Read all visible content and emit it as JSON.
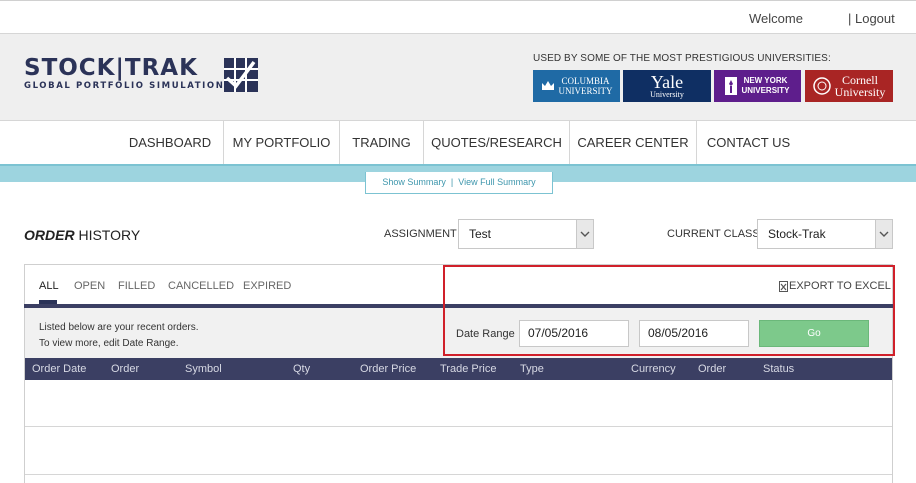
{
  "topbar": {
    "welcome": "Welcome",
    "logout": "| Logout"
  },
  "logo": {
    "name": "STOCK|TRAK",
    "tagline": "GLOBAL PORTFOLIO SIMULATIONS"
  },
  "universities": {
    "heading": "USED BY SOME OF THE MOST PRESTIGIOUS UNIVERSITIES:",
    "columbia_line1": "COLUMBIA",
    "columbia_line2": "UNIVERSITY",
    "yale_line1": "Yale",
    "yale_line2": "University",
    "nyu_line1": "NEW YORK",
    "nyu_line2": "UNIVERSITY",
    "cornell_line1": "Cornell",
    "cornell_line2": "University"
  },
  "nav": {
    "items": [
      {
        "label": "DASHBOARD"
      },
      {
        "label": "MY PORTFOLIO"
      },
      {
        "label": "TRADING"
      },
      {
        "label": "QUOTES/RESEARCH"
      },
      {
        "label": "CAREER CENTER"
      },
      {
        "label": "CONTACT US"
      }
    ]
  },
  "summary_toggle": {
    "show": "Show Summary",
    "separator": "|",
    "full": "View Full Summary"
  },
  "page": {
    "title_bold": "ORDER",
    "title_rest": "HISTORY"
  },
  "assignment": {
    "label": "ASSIGNMENT",
    "value": "Test"
  },
  "current_class": {
    "label": "CURRENT CLASS",
    "value": "Stock-Trak"
  },
  "tabs": [
    {
      "label": "ALL"
    },
    {
      "label": "OPEN"
    },
    {
      "label": "FILLED"
    },
    {
      "label": "CANCELLED"
    },
    {
      "label": "EXPIRED"
    }
  ],
  "export": {
    "label": "EXPORT TO EXCEL"
  },
  "info": {
    "line1": "Listed below are your recent orders.",
    "line2": "To view more, edit Date Range."
  },
  "date_range": {
    "label": "Date Range",
    "from": "07/05/2016",
    "to": "08/05/2016",
    "go_label": "Go"
  },
  "table": {
    "columns": [
      "Order Date",
      "Order",
      "Symbol",
      "Qty",
      "Order Price",
      "Trade Price",
      "Type",
      "Currency",
      "Order",
      "Status"
    ]
  },
  "colors": {
    "brand_navy": "#2b3358",
    "header_bar": "#3b3f63",
    "teal": "#9dd4df",
    "go_green": "#7dc98b",
    "highlight_red": "#d0202a"
  }
}
